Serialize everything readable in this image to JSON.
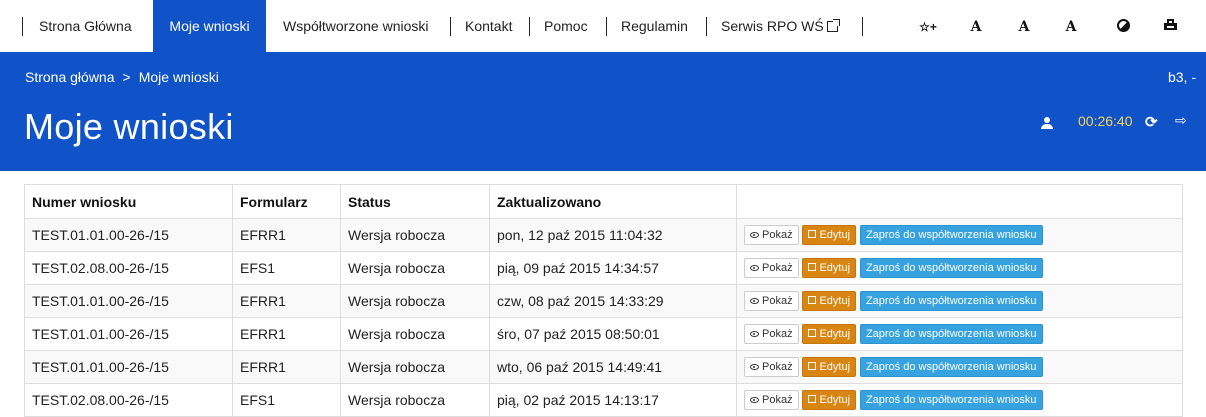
{
  "nav": {
    "items": [
      {
        "label": "Strona Główna"
      },
      {
        "label": "Moje wnioski"
      },
      {
        "label": "Współtworzone wnioski"
      },
      {
        "label": "Kontakt"
      },
      {
        "label": "Pomoc"
      },
      {
        "label": "Regulamin"
      },
      {
        "label": "Serwis RPO WŚ"
      }
    ],
    "active_index": 1,
    "tools": {
      "highlight_icon": "☆+",
      "font_normal": "A",
      "font_larger": "A",
      "font_largest": "A"
    }
  },
  "header": {
    "breadcrumb": {
      "home": "Strona główna",
      "separator": ">",
      "current": "Moje wnioski"
    },
    "user_short": "b3, -",
    "title": "Moje wnioski",
    "timer": "00:26:40"
  },
  "table": {
    "columns": [
      "Numer wniosku",
      "Formularz",
      "Status",
      "Zaktualizowano",
      ""
    ],
    "rows": [
      {
        "number": "TEST.01.01.00-26-/15",
        "form": "EFRR1",
        "status": "Wersja robocza",
        "updated": "pon, 12 paź 2015 11:04:32"
      },
      {
        "number": "TEST.02.08.00-26-/15",
        "form": "EFS1",
        "status": "Wersja robocza",
        "updated": "pią, 09 paź 2015 14:34:57"
      },
      {
        "number": "TEST.01.01.00-26-/15",
        "form": "EFRR1",
        "status": "Wersja robocza",
        "updated": "czw, 08 paź 2015 14:33:29"
      },
      {
        "number": "TEST.01.01.00-26-/15",
        "form": "EFRR1",
        "status": "Wersja robocza",
        "updated": "śro, 07 paź 2015 08:50:01"
      },
      {
        "number": "TEST.01.01.00-26-/15",
        "form": "EFRR1",
        "status": "Wersja robocza",
        "updated": "wto, 06 paź 2015 14:49:41"
      },
      {
        "number": "TEST.02.08.00-26-/15",
        "form": "EFS1",
        "status": "Wersja robocza",
        "updated": "pią, 02 paź 2015 14:13:17"
      }
    ],
    "actions": {
      "show": "Pokaż",
      "edit": "Edytuj",
      "invite": "Zaproś do współtworzenia wniosku"
    }
  },
  "colors": {
    "brand_blue": "#1053c8",
    "timer_yellow": "#f4d35e",
    "edit_orange": "#d98512",
    "invite_blue": "#36a3e0"
  },
  "icons": [
    "external-link-icon",
    "highlight-star-icon",
    "font-size-icon",
    "contrast-icon",
    "print-icon",
    "user-icon",
    "refresh-icon",
    "logout-icon",
    "eye-icon",
    "edit-icon"
  ]
}
